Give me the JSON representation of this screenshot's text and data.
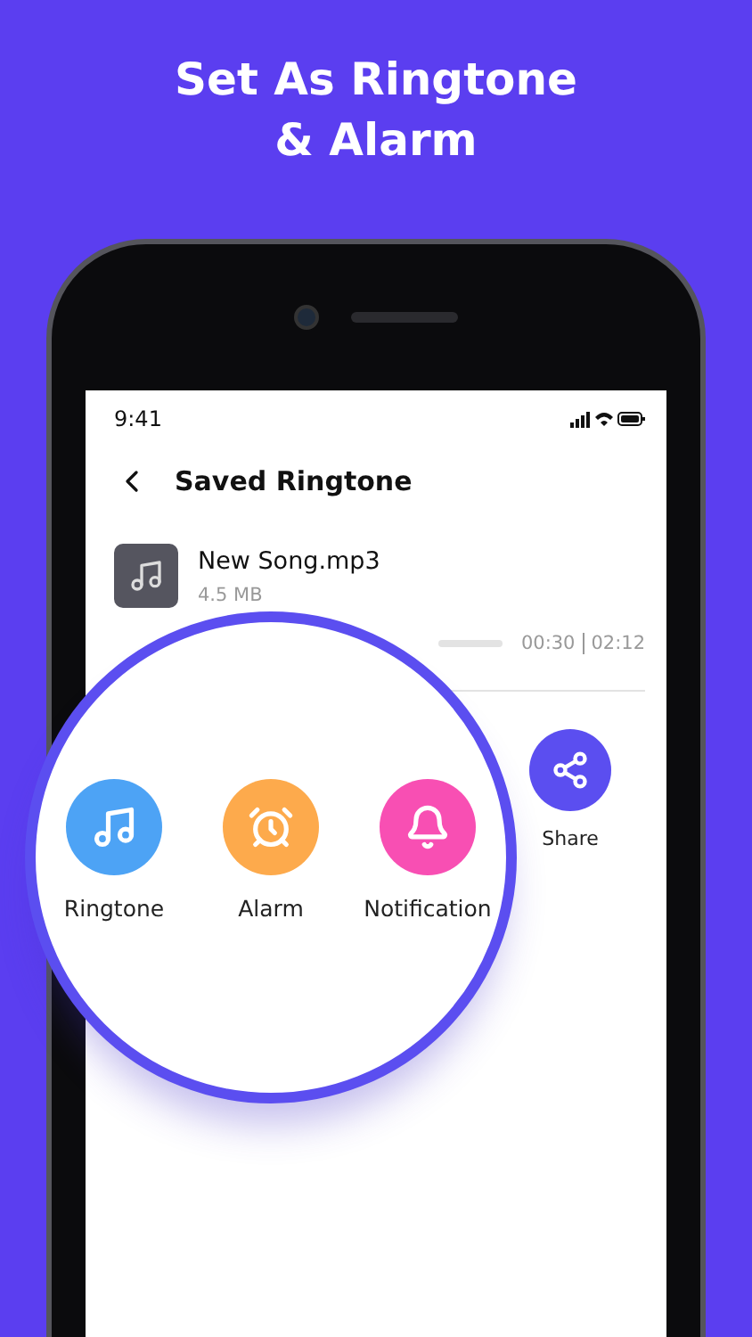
{
  "headline": [
    "Set As Ringtone",
    "& Alarm"
  ],
  "status_bar": {
    "time": "9:41"
  },
  "header": {
    "title": "Saved Ringtone"
  },
  "song": {
    "name": "New Song.mp3",
    "size": "4.5 MB"
  },
  "player": {
    "elapsed": "00:30",
    "duration": "02:12"
  },
  "actions": [
    {
      "label": "Ringtone",
      "kind": "ringtone",
      "color": "#4da3f5",
      "magnified": true
    },
    {
      "label": "Alarm",
      "kind": "alarm",
      "color": "#fdaa4c",
      "magnified": true
    },
    {
      "label": "Notification",
      "kind": "notification",
      "color": "#f84fb3",
      "magnified": true
    },
    {
      "label": "Share",
      "kind": "share",
      "color": "#5b4ef0",
      "magnified": false
    }
  ]
}
